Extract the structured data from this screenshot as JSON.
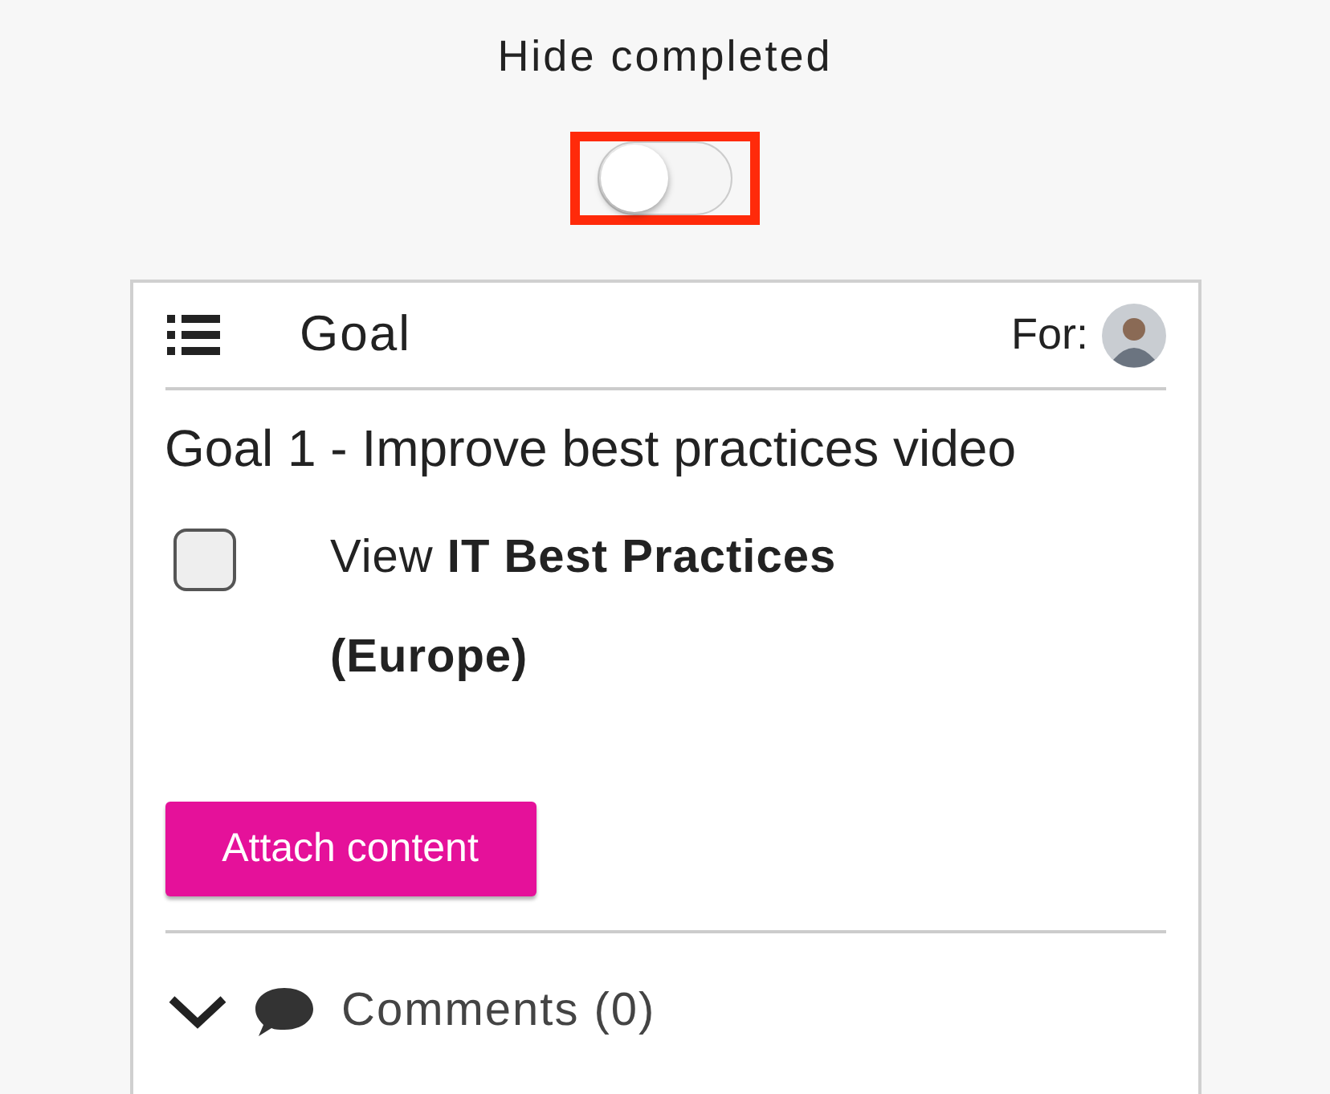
{
  "header": {
    "label": "Hide completed"
  },
  "toggle": {
    "on": false,
    "highlighted": true
  },
  "card": {
    "title": "Goal",
    "for_label": "For:",
    "goal_title": "Goal 1 - Improve best practices video",
    "tasks": [
      {
        "text": "View **IT Best Practices (Europe)**",
        "checked": false
      }
    ],
    "attach_button": "Attach content",
    "comments": {
      "label": "Comments (0)"
    }
  }
}
